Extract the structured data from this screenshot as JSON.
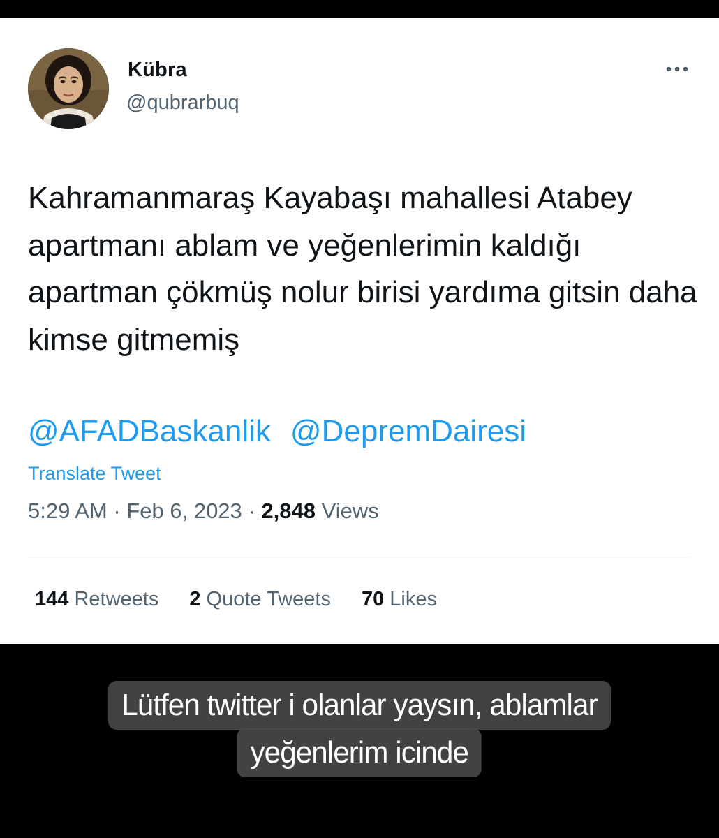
{
  "user": {
    "display_name": "Kübra",
    "handle": "@qubrarbuq"
  },
  "tweet": {
    "text": "Kahramanmaraş Kayabaşı mahallesi Atabey apartmanı ablam ve yeğenlerimin kaldığı apartman çökmüş nolur birisi yardıma gitsin daha kimse gitmemiş",
    "mentions": [
      "@AFADBaskanlik",
      "@DepremDairesi"
    ],
    "translate_label": "Translate Tweet",
    "time": "5:29 AM",
    "date": "Feb 6, 2023",
    "separator": "·",
    "views_count": "2,848",
    "views_label": "Views"
  },
  "stats": {
    "retweets_count": "144",
    "retweets_label": "Retweets",
    "quotes_count": "2",
    "quotes_label": "Quote Tweets",
    "likes_count": "70",
    "likes_label": "Likes"
  },
  "caption": {
    "line1": "Lütfen twitter i olanlar yaysın, ablamlar",
    "line2": "yeğenlerim icinde"
  },
  "icons": {
    "more": "more-horizontal-icon"
  },
  "colors": {
    "accent": "#1d9bf0",
    "text_primary": "#0f1419",
    "text_secondary": "#536471",
    "background": "#ffffff",
    "frame": "#000000"
  }
}
